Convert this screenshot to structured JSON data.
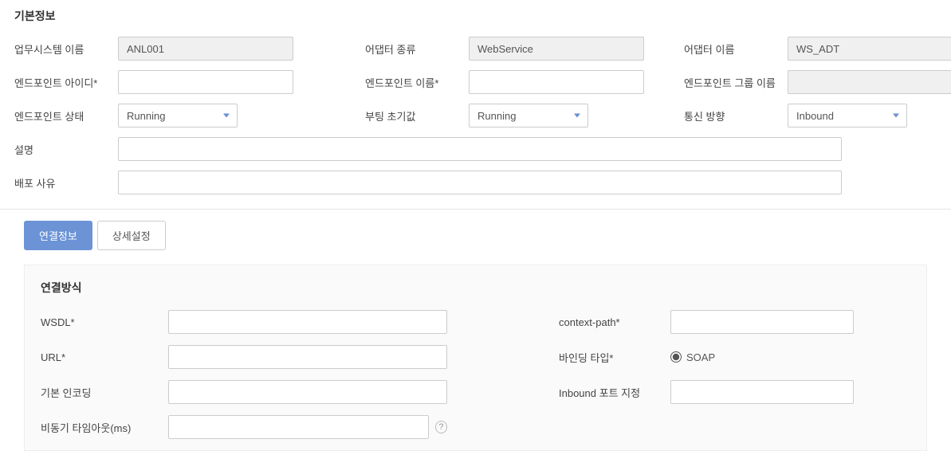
{
  "basicInfo": {
    "sectionTitle": "기본정보",
    "labels": {
      "systemName": "업무시스템 이름",
      "adapterType": "어댑터 종류",
      "adapterName": "어댑터 이름",
      "endpointId": "엔드포인트 아이디*",
      "endpointName": "엔드포인트 이름*",
      "endpointGroupName": "엔드포인트 그룹 이름",
      "endpointStatus": "엔드포인트 상태",
      "bootInit": "부팅 초기값",
      "commDirection": "통신 방향",
      "description": "설명",
      "deployReason": "배포 사유"
    },
    "values": {
      "systemName": "ANL001",
      "adapterType": "WebService",
      "adapterName": "WS_ADT",
      "endpointId": "",
      "endpointName": "",
      "endpointGroupName": "",
      "endpointStatus": "Running",
      "bootInit": "Running",
      "commDirection": "Inbound",
      "description": "",
      "deployReason": ""
    }
  },
  "tabs": {
    "connection": "연결정보",
    "detail": "상세설정"
  },
  "connection": {
    "sectionTitle": "연결방식",
    "labels": {
      "wsdl": "WSDL*",
      "contextPath": "context-path*",
      "url": "URL*",
      "bindingType": "바인딩 타입*",
      "encoding": "기본 인코딩",
      "inboundPort": "Inbound 포트 지정",
      "asyncTimeout": "비동기 타임아웃(ms)"
    },
    "values": {
      "wsdl": "",
      "contextPath": "",
      "url": "",
      "encoding": "",
      "inboundPort": "",
      "asyncTimeout": "",
      "bindingTypeSoap": "SOAP"
    }
  }
}
